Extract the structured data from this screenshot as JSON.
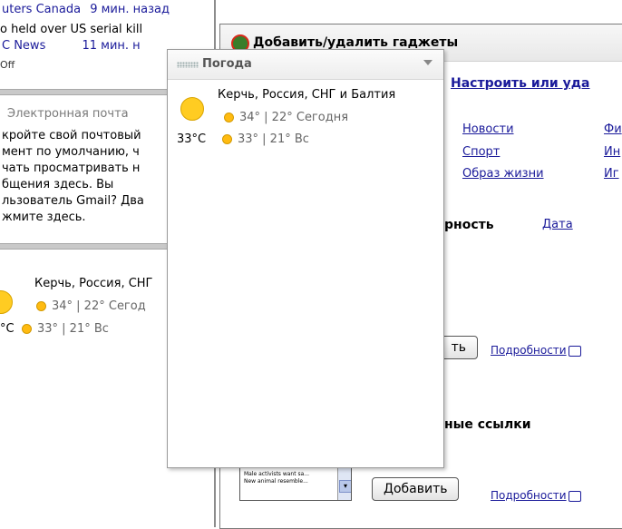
{
  "sidebar": {
    "news": [
      {
        "source": "uters Canada",
        "time": "9 мин. назад"
      },
      {
        "headline": "o held over US serial kill"
      },
      {
        "source": "C News",
        "time": "11 мин. н"
      },
      {
        "headline": "Off"
      }
    ],
    "email": {
      "title": "Электронная почта",
      "lines": [
        "кройте свой почтовый",
        "мент по умолчанию, ч",
        "чать просматривать н",
        "бщения здесь. Вы",
        "льзователь Gmail? Два",
        "жмите здесь."
      ]
    },
    "weather": {
      "location": "Керчь, Россия, СНГ",
      "today": "34° | 22° Сегод",
      "current_temp": "°C",
      "tomorrow": "33° | 21° Вс"
    }
  },
  "dialog": {
    "title": "Добавить/удалить гаджеты",
    "customize_link": "Настроить или уда",
    "categories": [
      "Новости",
      "Спорт",
      "Образ жизни",
      "Фи",
      "Ин",
      "Иг"
    ],
    "sort_label": "рность",
    "sort_date_link": "Дата",
    "add_button_partial": "ть",
    "details_link": "Подробности",
    "section_title": "ные ссылки",
    "add_button": "Добавить",
    "details_link_2": "Подробности",
    "thumbnail_lines": [
      "Cubicles! The great m...",
      "Male activists want sa...",
      "New animal resemble..."
    ]
  },
  "popup": {
    "title": "Погода",
    "location": "Керчь, Россия, СНГ и Балтия",
    "today": "34° | 22° Сегодня",
    "current_temp": "33°C",
    "tomorrow": "33° | 21° Вс"
  },
  "colors": {
    "link": "#1a1a9a",
    "sun": "#ffcc22",
    "frame": "#8c8c8c"
  }
}
